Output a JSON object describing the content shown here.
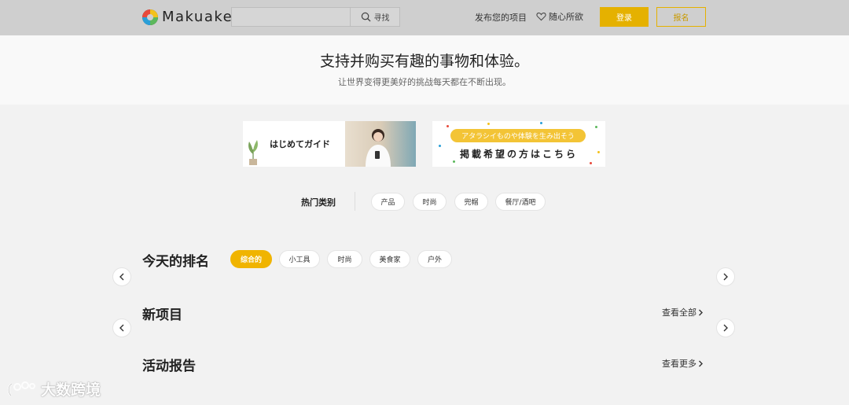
{
  "header": {
    "logo_text": "Makuake",
    "search": {
      "placeholder": "",
      "button_label": "寻找"
    },
    "nav_post": "发布您的项目",
    "nav_wishlist": "随心所欲",
    "login": "登录",
    "signup": "报名",
    "colors": {
      "accent": "#e5b100",
      "bar": "#cfcfcf"
    }
  },
  "hero": {
    "title": "支持并购买有趣的事物和体验。",
    "subtitle": "让世界变得更美好的挑战每天都在不断出现。"
  },
  "banners": {
    "guide_text": "はじめてガイド",
    "publish_pill": "アタラシイものや体験を生み出そう",
    "publish_text": "掲載希望の方はこちら"
  },
  "popular": {
    "label": "热门类别",
    "chips": [
      "产品",
      "时尚",
      "兜帽",
      "餐厅/酒吧"
    ]
  },
  "ranking": {
    "title": "今天的排名",
    "tabs": [
      "综合的",
      "小工具",
      "时尚",
      "美食家",
      "户外"
    ],
    "active_tab": "综合的"
  },
  "new_projects": {
    "title": "新项目",
    "see_all": "查看全部"
  },
  "activity": {
    "title": "活动报告",
    "see_more": "查看更多"
  },
  "watermark": {
    "text": "大数跨境"
  }
}
